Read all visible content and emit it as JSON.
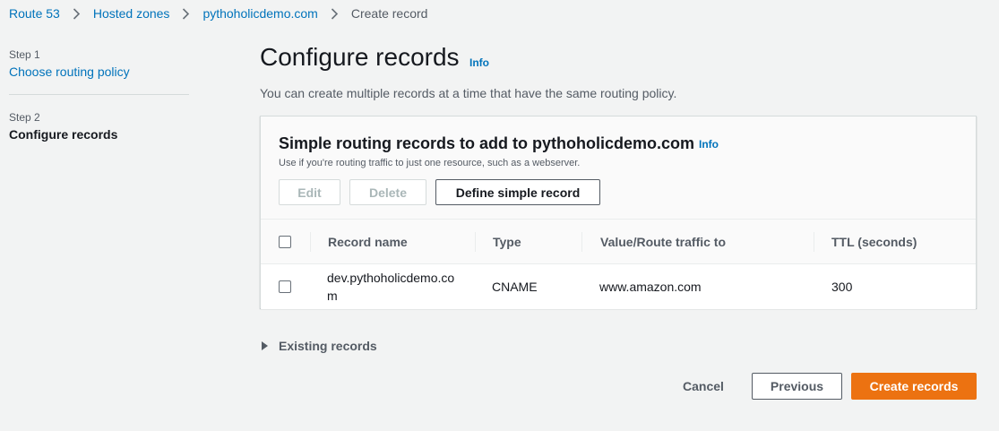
{
  "breadcrumb": {
    "items": [
      "Route 53",
      "Hosted zones",
      "pythoholicdemo.com"
    ],
    "current": "Create record"
  },
  "steps": {
    "step1_num": "Step 1",
    "step1_label": "Choose routing policy",
    "step2_num": "Step 2",
    "step2_label": "Configure records"
  },
  "page": {
    "title": "Configure records",
    "info": "Info",
    "description": "You can create multiple records at a time that have the same routing policy."
  },
  "panel": {
    "title": "Simple routing records to add to pythoholicdemo.com",
    "info": "Info",
    "description": "Use if you're routing traffic to just one resource, such as a webserver.",
    "edit_label": "Edit",
    "delete_label": "Delete",
    "define_label": "Define simple record"
  },
  "table": {
    "headers": [
      "Record name",
      "Type",
      "Value/Route traffic to",
      "TTL (seconds)"
    ],
    "rows": [
      {
        "record_name": "dev.pythoholicdemo.com",
        "type": "CNAME",
        "value": "www.amazon.com",
        "ttl": "300"
      }
    ]
  },
  "existing_records": "Existing records",
  "footer": {
    "cancel": "Cancel",
    "previous": "Previous",
    "create": "Create records"
  },
  "colors": {
    "link": "#0073bb",
    "primary": "#ec7211",
    "background": "#f2f3f3"
  },
  "icons": {
    "breadcrumb_separator": "chevron-right-icon",
    "expand": "caret-right-icon"
  }
}
